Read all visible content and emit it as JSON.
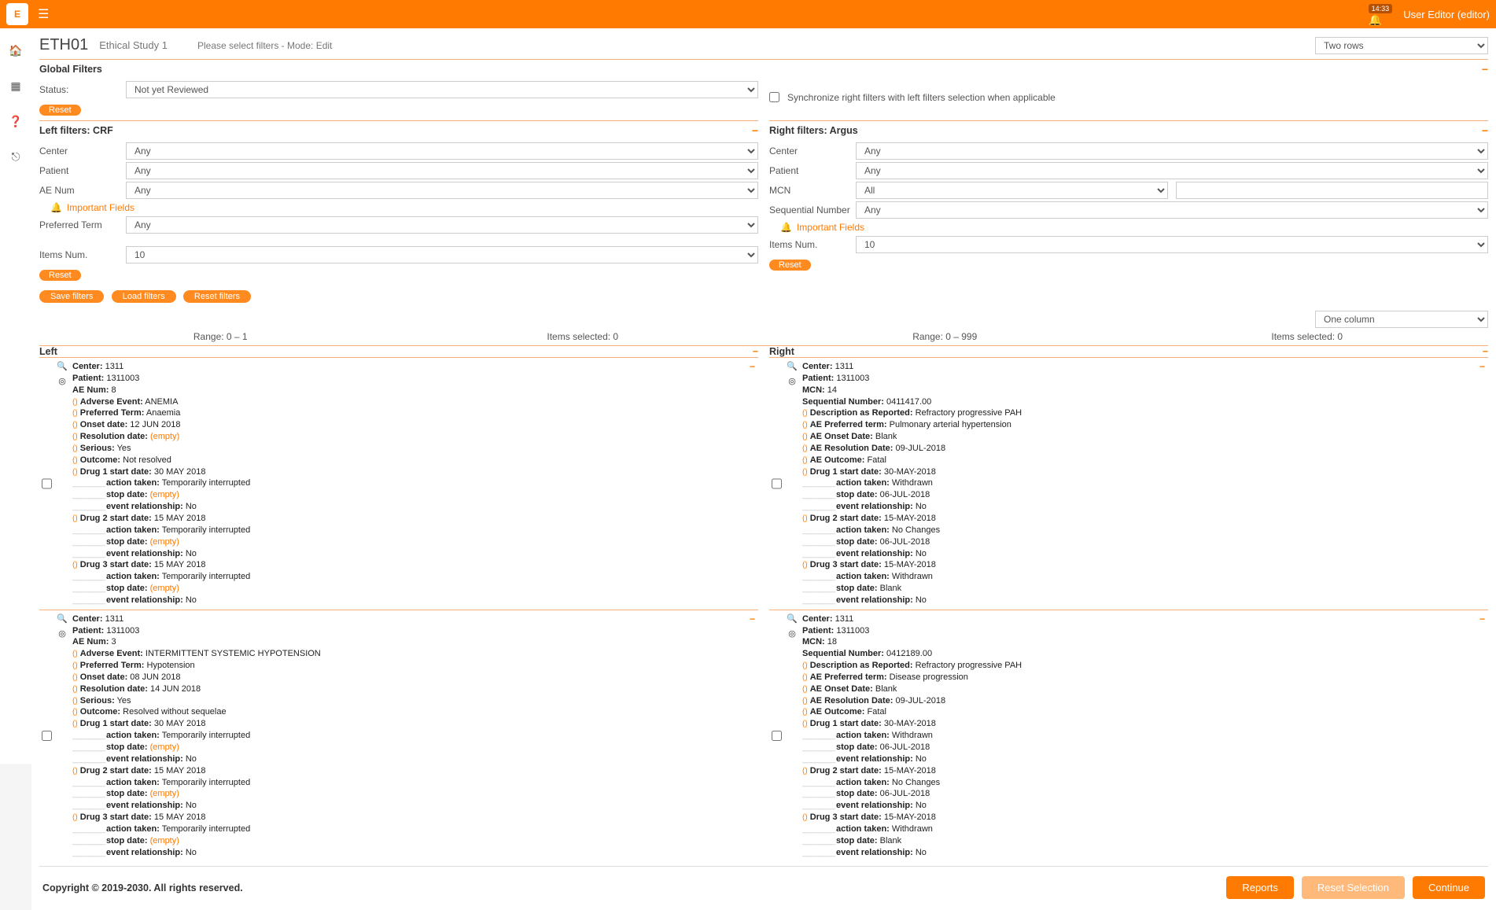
{
  "topbar": {
    "notification_time": "14:33",
    "user": "User Editor (editor)"
  },
  "header": {
    "code": "ETH01",
    "study": "Ethical Study 1",
    "mode_text": "Please select filters - Mode: Edit",
    "rows_select": "Two rows"
  },
  "global_filters": {
    "title": "Global Filters",
    "status_label": "Status:",
    "status_value": "Not yet Reviewed",
    "reset": "Reset",
    "sync_label": "Synchronize right filters with left filters selection when applicable"
  },
  "left_filters": {
    "title": "Left filters: CRF",
    "rows": [
      {
        "label": "Center",
        "value": "Any"
      },
      {
        "label": "Patient",
        "value": "Any"
      },
      {
        "label": "AE Num",
        "value": "Any"
      }
    ],
    "important": "Important Fields",
    "preferred_term_label": "Preferred Term",
    "preferred_term_value": "Any",
    "items_label": "Items Num.",
    "items_value": "10",
    "reset": "Reset"
  },
  "right_filters": {
    "title": "Right filters: Argus",
    "rows": [
      {
        "label": "Center",
        "value": "Any"
      },
      {
        "label": "Patient",
        "value": "Any"
      }
    ],
    "mcn_label": "MCN",
    "mcn_value": "All",
    "seq_label": "Sequential Number",
    "seq_value": "Any",
    "important": "Important Fields",
    "items_label": "Items Num.",
    "items_value": "10",
    "reset": "Reset"
  },
  "filter_actions": {
    "save": "Save filters",
    "load": "Load filters",
    "reset": "Reset filters"
  },
  "column_select": "One column",
  "stats": {
    "left_range": "Range: 0 – 1",
    "left_selected": "Items selected: 0",
    "right_range": "Range: 0 – 999",
    "right_selected": "Items selected: 0"
  },
  "section_titles": {
    "left": "Left",
    "right": "Right"
  },
  "left_cards": [
    {
      "center": "1311",
      "patient": "1311003",
      "ae_num": "8",
      "ae": "ANEMIA",
      "pt": "Anaemia",
      "onset": "12 JUN 2018",
      "resolution": "(empty)",
      "res_empty": true,
      "serious": "Yes",
      "outcome": "Not resolved",
      "drugs": [
        {
          "label": "Drug 1 start date:",
          "start": "30 MAY 2018",
          "action": "Temporarily interrupted",
          "stop": "(empty)",
          "stop_empty": true,
          "rel": "No"
        },
        {
          "label": "Drug 2 start date:",
          "start": "15 MAY 2018",
          "action": "Temporarily interrupted",
          "stop": "(empty)",
          "stop_empty": true,
          "rel": "No"
        },
        {
          "label": "Drug 3 start date:",
          "start": "15 MAY 2018",
          "action": "Temporarily interrupted",
          "stop": "(empty)",
          "stop_empty": true,
          "rel": "No"
        }
      ]
    },
    {
      "center": "1311",
      "patient": "1311003",
      "ae_num": "3",
      "ae": "INTERMITTENT SYSTEMIC HYPOTENSION",
      "pt": "Hypotension",
      "onset": "08 JUN 2018",
      "resolution": "14 JUN 2018",
      "res_empty": false,
      "serious": "Yes",
      "outcome": "Resolved without sequelae",
      "drugs": [
        {
          "label": "Drug 1 start date:",
          "start": "30 MAY 2018",
          "action": "Temporarily interrupted",
          "stop": "(empty)",
          "stop_empty": true,
          "rel": "No"
        },
        {
          "label": "Drug 2 start date:",
          "start": "15 MAY 2018",
          "action": "Temporarily interrupted",
          "stop": "(empty)",
          "stop_empty": true,
          "rel": "No"
        },
        {
          "label": "Drug 3 start date:",
          "start": "15 MAY 2018",
          "action": "Temporarily interrupted",
          "stop": "(empty)",
          "stop_empty": true,
          "rel": "No"
        }
      ]
    }
  ],
  "right_cards": [
    {
      "center": "1311",
      "patient": "1311003",
      "mcn": "14",
      "seq": "0411417.00",
      "desc": "Refractory progressive PAH",
      "pt": "Pulmonary arterial hypertension",
      "onset": "Blank",
      "resolution": "09-JUL-2018",
      "outcome": "Fatal",
      "drugs": [
        {
          "label": "Drug 1 start date:",
          "start": "30-MAY-2018",
          "action": "Withdrawn",
          "stop": "06-JUL-2018",
          "rel": "No"
        },
        {
          "label": "Drug 2 start date:",
          "start": "15-MAY-2018",
          "action": "No Changes",
          "stop": "06-JUL-2018",
          "rel": "No"
        },
        {
          "label": "Drug 3 start date:",
          "start": "15-MAY-2018",
          "action": "Withdrawn",
          "stop": "Blank",
          "rel": "No"
        }
      ]
    },
    {
      "center": "1311",
      "patient": "1311003",
      "mcn": "18",
      "seq": "0412189.00",
      "desc": "Refractory progressive PAH",
      "pt": "Disease progression",
      "onset": "Blank",
      "resolution": "09-JUL-2018",
      "outcome": "Fatal",
      "drugs": [
        {
          "label": "Drug 1 start date:",
          "start": "30-MAY-2018",
          "action": "Withdrawn",
          "stop": "06-JUL-2018",
          "rel": "No"
        },
        {
          "label": "Drug 2 start date:",
          "start": "15-MAY-2018",
          "action": "No Changes",
          "stop": "06-JUL-2018",
          "rel": "No"
        },
        {
          "label": "Drug 3 start date:",
          "start": "15-MAY-2018",
          "action": "Withdrawn",
          "stop": "Blank",
          "rel": "No"
        }
      ]
    }
  ],
  "footer": {
    "copy": "Copyright © 2019-2030. All rights reserved.",
    "reports": "Reports",
    "reset_sel": "Reset Selection",
    "continue": "Continue"
  }
}
